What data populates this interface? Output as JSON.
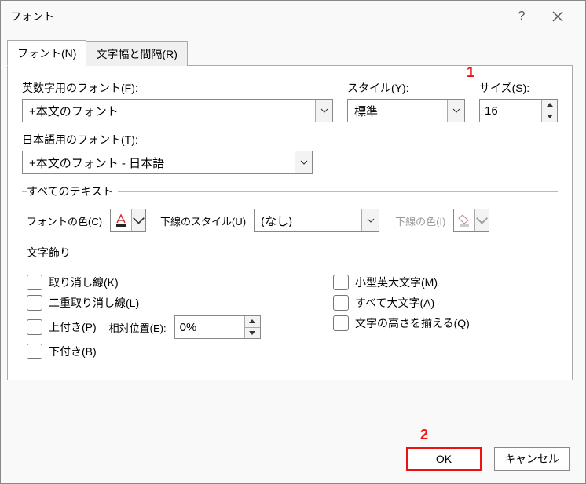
{
  "titlebar": {
    "title": "フォント"
  },
  "tabs": {
    "font": "フォント(N)",
    "spacing": "文字幅と間隔(R)"
  },
  "labels": {
    "latinFont": "英数字用のフォント(F):",
    "style": "スタイル(Y):",
    "size": "サイズ(S):",
    "asianFont": "日本語用のフォント(T):",
    "allText": "すべてのテキスト",
    "fontColor": "フォントの色(C)",
    "underlineStyle": "下線のスタイル(U)",
    "underlineColor": "下線の色(I)",
    "effects": "文字飾り",
    "relPos": "相対位置(E):"
  },
  "values": {
    "latinFont": "+本文のフォント",
    "style": "標準",
    "size": "16",
    "asianFont": "+本文のフォント - 日本語",
    "underlineStyle": "(なし)",
    "relPos": "0%"
  },
  "checks": {
    "strike": "取り消し線(K)",
    "dblStrike": "二重取り消し線(L)",
    "superscript": "上付き(P)",
    "subscript": "下付き(B)",
    "smallCaps": "小型英大文字(M)",
    "allCaps": "すべて大文字(A)",
    "equalize": "文字の高さを揃える(Q)"
  },
  "buttons": {
    "ok": "OK",
    "cancel": "キャンセル"
  },
  "callouts": {
    "one": "1",
    "two": "2"
  }
}
